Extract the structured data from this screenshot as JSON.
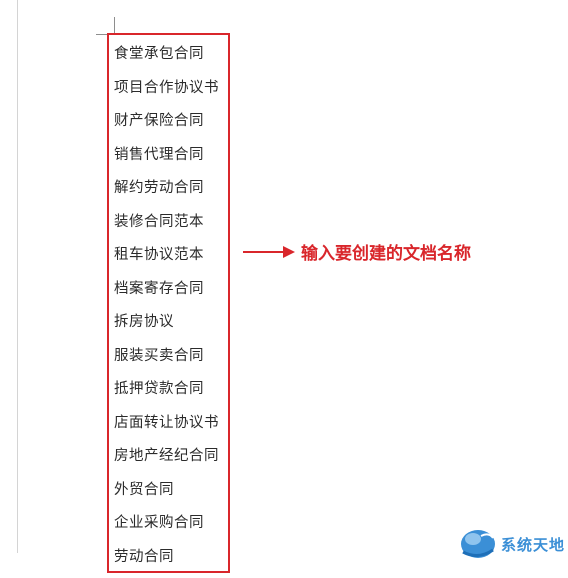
{
  "document_names": [
    "食堂承包合同",
    "项目合作协议书",
    "财产保险合同",
    "销售代理合同",
    "解约劳动合同",
    "装修合同范本",
    "租车协议范本",
    "档案寄存合同",
    "拆房协议",
    "服装买卖合同",
    "抵押贷款合同",
    "店面转让协议书",
    "房地产经纪合同",
    "外贸合同",
    "企业采购合同",
    "劳动合同"
  ],
  "annotation": {
    "text": "输入要创建的文档名称",
    "color": "#d9262b",
    "arrow_icon": "right-arrow-icon"
  },
  "watermark": {
    "text": "系统天地",
    "color": "#3b8fd6",
    "icon": "system-logo-icon"
  },
  "colors": {
    "highlight_border": "#d9262b",
    "text": "#2b2b2b"
  }
}
